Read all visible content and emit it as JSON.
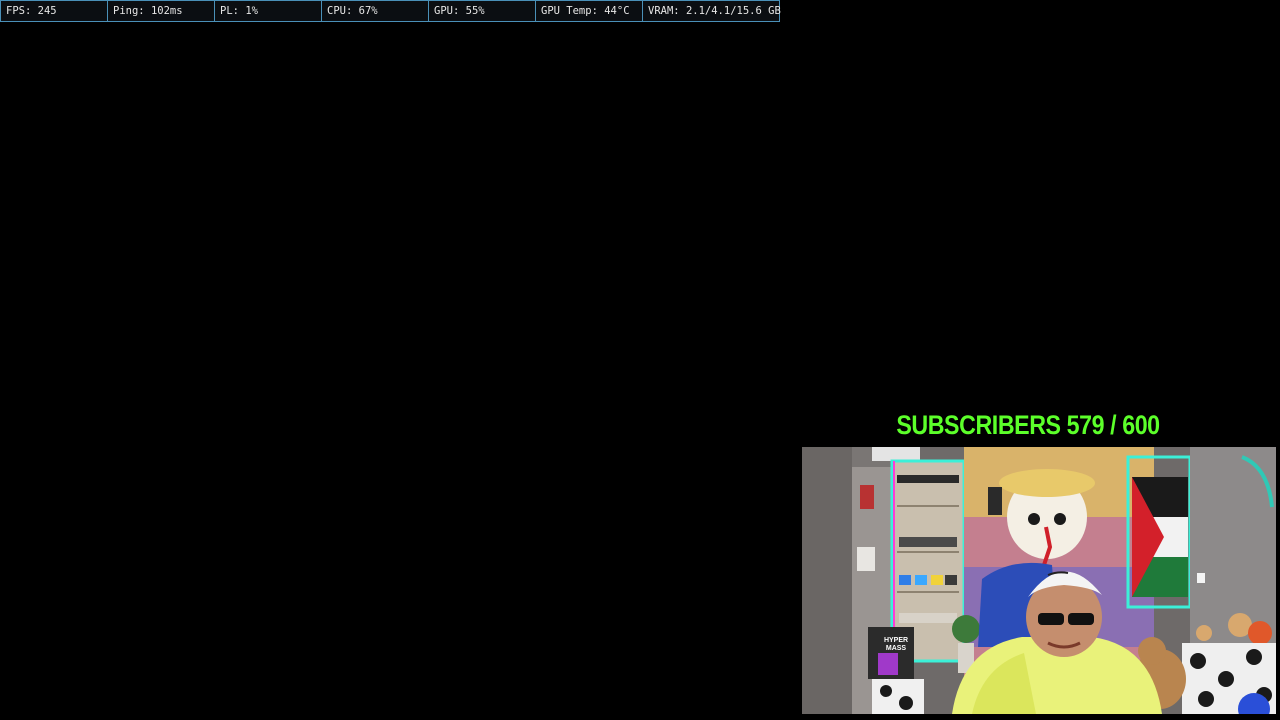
{
  "perf_overlay": {
    "fps": {
      "label": "FPS",
      "value": "245"
    },
    "ping": {
      "label": "Ping",
      "value": "102ms"
    },
    "pl": {
      "label": "PL",
      "value": "1%"
    },
    "cpu": {
      "label": "CPU",
      "value": "67%"
    },
    "gpu": {
      "label": "GPU",
      "value": "55%"
    },
    "gpu_temp": {
      "label": "GPU Temp",
      "value": "44°C"
    },
    "vram": {
      "label": "VRAM",
      "value": "2.1/4.1/15.6 GB"
    }
  },
  "subscriber_goal": {
    "label": "SUBSCRIBERS",
    "current": "579",
    "separator": "/",
    "target": "600"
  },
  "webcam": {
    "bag_text": "HYPER MASS"
  },
  "colors": {
    "overlay_border": "#4a90b8",
    "goal_text": "#5cff2a",
    "background": "#000000"
  }
}
